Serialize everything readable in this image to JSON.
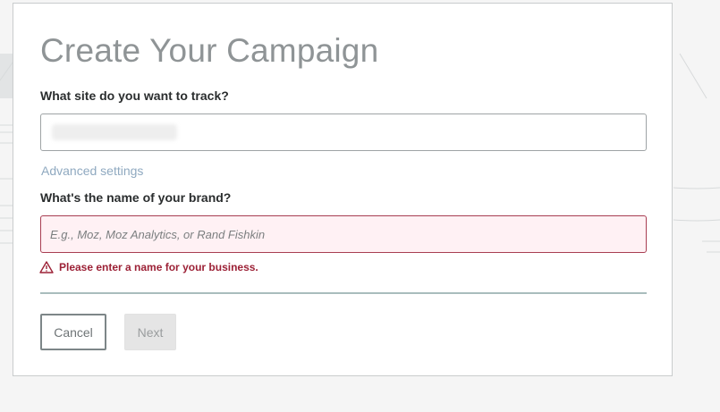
{
  "modal": {
    "title": "Create Your Campaign",
    "site_question": "What site do you want to track?",
    "site_value": "",
    "advanced_settings": "Advanced settings",
    "brand_question": "What's the name of your brand?",
    "brand_placeholder": "E.g., Moz, Moz Analytics, or Rand Fishkin",
    "brand_value": "",
    "error_message": "Please enter a name for your business.",
    "cancel_label": "Cancel",
    "next_label": "Next"
  },
  "icons": {
    "error": "warning-triangle-icon"
  },
  "colors": {
    "error": "#9c2136",
    "link": "#8fa9c0",
    "title": "#8f9496",
    "divider": "#a9bdbd"
  }
}
